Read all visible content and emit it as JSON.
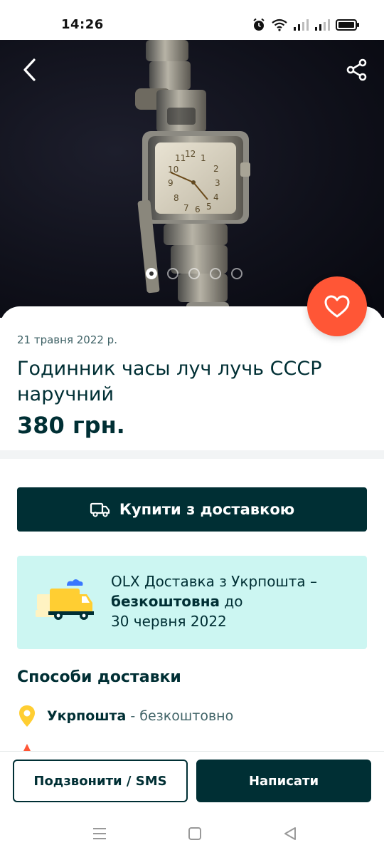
{
  "status_bar": {
    "time": "14:26",
    "icons": [
      "alarm-icon",
      "wifi-icon",
      "signal-icon",
      "signal-icon",
      "battery-icon"
    ]
  },
  "gallery": {
    "photo": "watch-photo",
    "image_count": 5,
    "active_index": 0,
    "back_icon": "chevron-left-icon",
    "share_icon": "share-icon",
    "favorite_icon": "heart-icon"
  },
  "ad": {
    "date": "21 травня 2022 р.",
    "title": "Годинник часы луч лучь СССР наручний",
    "price": "380 грн."
  },
  "buy": {
    "label": "Купити з доставкою",
    "icon": "truck-icon"
  },
  "promo": {
    "line1": "OLX Доставка з Укрпошта –",
    "bold": "безкоштовна",
    "line2_rest": " до",
    "line3": "30 червня 2022",
    "illustration": "delivery-truck-illustration"
  },
  "delivery": {
    "section_title": "Способи доставки",
    "options": [
      {
        "icon": "location-pin-icon",
        "name": "Укрпошта",
        "note": " - безкоштовно"
      }
    ]
  },
  "actions": {
    "call_label": "Подзвонити / SMS",
    "write_label": "Написати"
  },
  "colors": {
    "brand_dark": "#002f34",
    "favorite": "#ff5636",
    "promo_bg": "#ccf6f2",
    "pin": "#ffce32"
  }
}
